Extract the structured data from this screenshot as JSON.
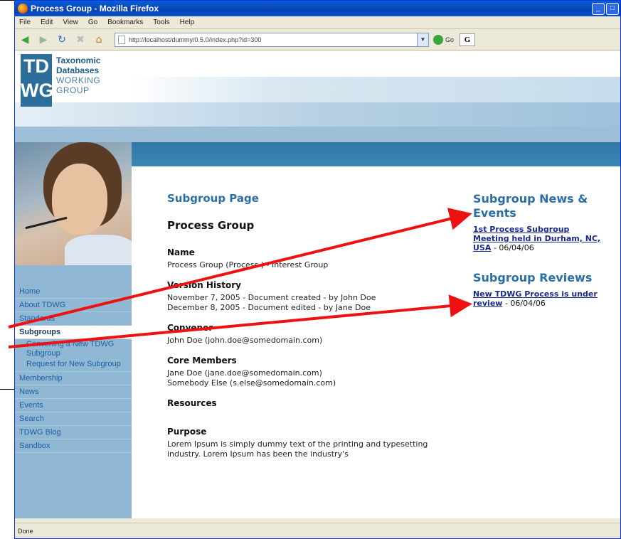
{
  "window": {
    "title": "Process Group - Mozilla Firefox",
    "controls": [
      "_",
      "□"
    ]
  },
  "menu": [
    "File",
    "Edit",
    "View",
    "Go",
    "Bookmarks",
    "Tools",
    "Help"
  ],
  "toolbar": {
    "url": "http://localhost/dummy/0.5.0/index.php?id=300",
    "go_label": "Go",
    "search_engine": "G"
  },
  "logo": {
    "mark_top": "TD",
    "mark_bottom": "WG",
    "line1": "Taxonomic",
    "line2": "Databases",
    "line3": "WORKING",
    "line4": "GROUP"
  },
  "sidebar": {
    "items": [
      {
        "label": "Home"
      },
      {
        "label": "About TDWG"
      },
      {
        "label": "Standards"
      },
      {
        "label": "Subgroups",
        "active": true
      },
      {
        "label": "Membership"
      },
      {
        "label": "News"
      },
      {
        "label": "Events"
      },
      {
        "label": "Search"
      },
      {
        "label": "TDWG Blog"
      },
      {
        "label": "Sandbox"
      }
    ],
    "subitems": [
      "Convening a New TDWG Subgroup",
      "Request for New Subgroup"
    ]
  },
  "main": {
    "subgroup_page": "Subgroup Page",
    "page_title": "Process Group",
    "name_heading": "Name",
    "name_value": "Process Group (Process ) - Interest Group",
    "version_heading": "Version History",
    "version_1": "November 7, 2005 - Document created - by John Doe",
    "version_2": "December 8, 2005 - Document edited - by Jane Doe",
    "convener_heading": "Convener",
    "convener_value": "John Doe (john.doe@somedomain.com)",
    "core_heading": "Core Members",
    "core_1": "Jane Doe (jane.doe@somedomain.com)",
    "core_2": "Somebody Else (s.else@somedomain.com)",
    "resources_heading": "Resources",
    "purpose_heading": "Purpose",
    "purpose_text": "Lorem Ipsum is simply dummy text of the printing and typesetting industry. Lorem Ipsum has been the industry's"
  },
  "news": {
    "heading": "Subgroup News & Events",
    "item_link": "1st Process Subgroup Meeting held in Durham, NC, USA",
    "item_date": " - 06/04/06",
    "reviews_heading": "Subgroup Reviews",
    "review_link": "New TDWG Process is under review",
    "review_date": " - 06/04/06"
  },
  "status": "Done",
  "colors": {
    "accent": "#2b6ea3",
    "annotation_arrow": "#ee1111"
  },
  "icons": [
    "firefox-icon",
    "back-icon",
    "forward-icon",
    "reload-icon",
    "stop-icon",
    "home-icon",
    "go-icon",
    "search-engine-icon"
  ]
}
